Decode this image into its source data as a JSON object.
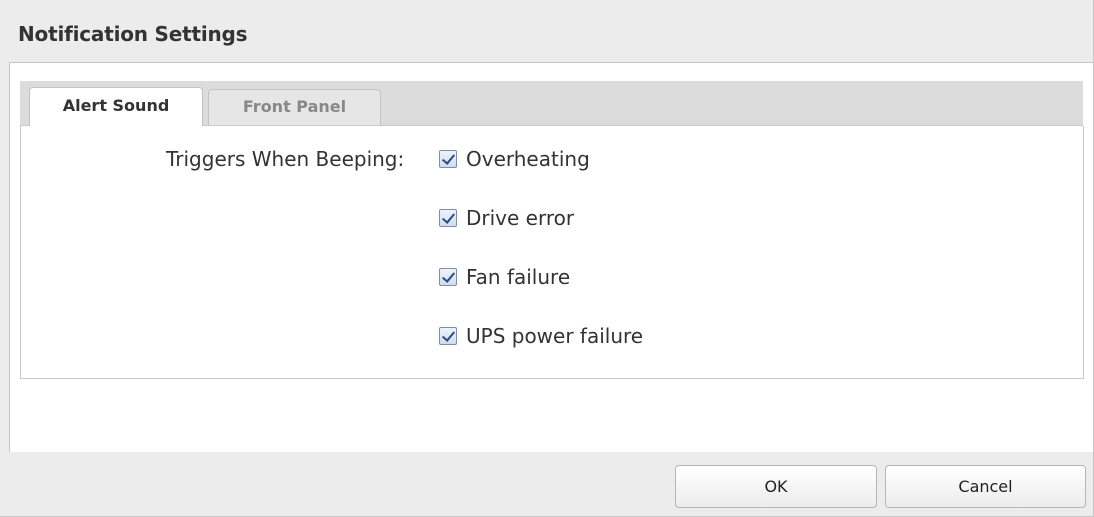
{
  "dialog": {
    "title": "Notification Settings"
  },
  "help": {
    "icon": "help-icon",
    "icon_glyph": "?",
    "dropdown_icon": "chevron-down-icon"
  },
  "tabs": [
    {
      "label": "Alert Sound",
      "active": true
    },
    {
      "label": "Front Panel",
      "active": false
    }
  ],
  "alert_sound": {
    "field_label": "Triggers When Beeping:",
    "options": [
      {
        "label": "Overheating",
        "checked": true
      },
      {
        "label": "Drive error",
        "checked": true
      },
      {
        "label": "Fan failure",
        "checked": true
      },
      {
        "label": "UPS power failure",
        "checked": true
      }
    ]
  },
  "footer": {
    "ok_label": "OK",
    "cancel_label": "Cancel"
  },
  "colors": {
    "help_icon": "#1a60b8",
    "check_mark": "#2b4a8e"
  }
}
